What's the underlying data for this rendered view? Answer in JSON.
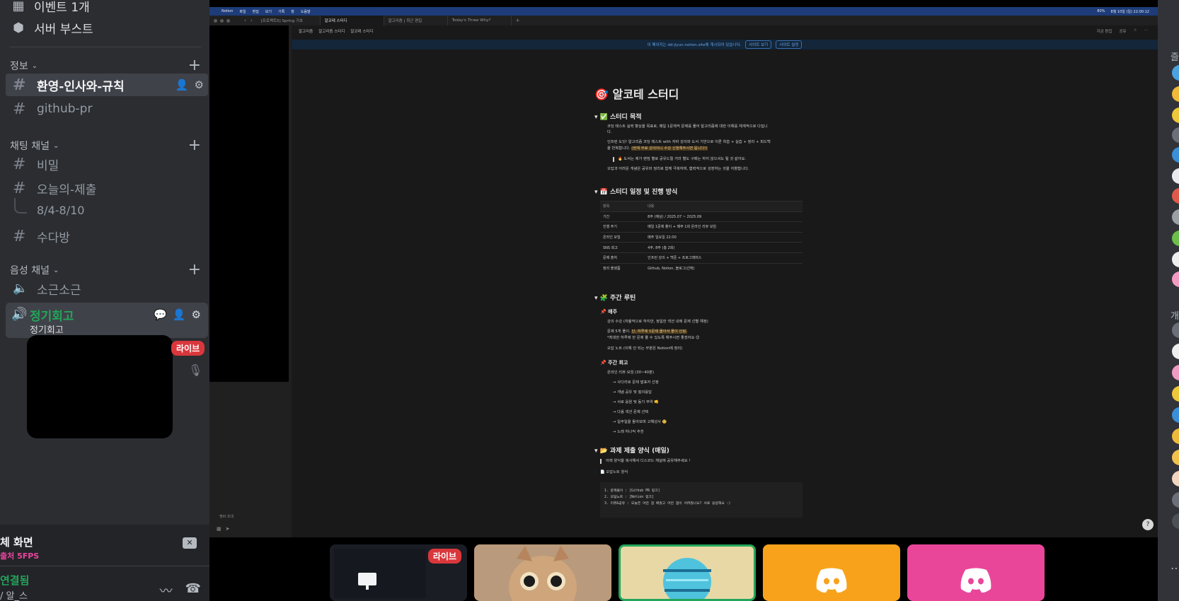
{
  "sidebar": {
    "top_items": [
      {
        "label": "이벤트 1개",
        "icon": "calendar-icon"
      },
      {
        "label": "서버 부스트",
        "icon": "boost-icon"
      }
    ],
    "categories": {
      "info": "정보",
      "chat": "채팅 채널",
      "voice": "음성 채널"
    },
    "channels": {
      "welcome": "환영-인사와-규칙",
      "github": "github-pr",
      "secret": "비밀",
      "submit": "오늘의-제출",
      "thread": "8/4-8/10",
      "talk": "수다방"
    },
    "voice_channels": {
      "quiet": "소근소근",
      "regular": "정기회고",
      "regular_sub": "정기회고"
    },
    "live_badge": "라이브"
  },
  "bottom_panel": {
    "screen_label": "체 화면",
    "screen_sub": "출처 5FPS",
    "connected_label": "연결됨",
    "connected_sub": "/ 알_스"
  },
  "stream": {
    "menubar": {
      "items": [
        "Notion",
        "파일",
        "편집",
        "보기",
        "기록",
        "창",
        "도움말"
      ],
      "clock": "8월 10일 (일) 22:00:12",
      "battery": "80%"
    },
    "tabs": [
      "[프로젝트5] Spring 기초",
      "알코테 스터디",
      "알고리즘 | 최근 편집",
      "Today's Three Why?"
    ],
    "breadcrumb": [
      "알고리즘",
      "알고리즘 스터디",
      "알코테 스터디"
    ],
    "top_right": [
      "지금 편집",
      "공유",
      "☆",
      "⋯"
    ],
    "banner": {
      "text": "이 페이지는 dd-jiyun.notion.site에 게시되어 있습니다.",
      "view_site": "사이트 보기",
      "site_settings": "사이트 설정"
    },
    "sidebar_bottom": "멤버 초대",
    "doc": {
      "title": "알코테 스터디",
      "sec1": "✅ 스터디 목적",
      "sec1_lines": [
        "코딩 테스트 실력 향상을 목표로, 매일 1문제씩 문제를 풀어 알고리즘에 대한 이해를 체계적으로 다집니",
        "다.",
        "인프런 도잇! 알고리즘 코딩 테스트 with 자바 강의와 도서 기반으로 이론 학습 + 실습 + 정리 + 피드백",
        "을 반복합니다.",
        "(현재 무료 강의이니 수강 신청해주시면 됩니다!)",
        "🔥 도서는 제가 랜덤 별로 공유드릴 거라 별도 구매는 하지 않으셔도 될 것 같아요.",
        "오답과 어려운 개념은 공유와 정리로 함께 극복하며, 협력적으로 성장하는 것을 지향합니다."
      ],
      "sec2": "📅 스터디 일정 및 진행 방식",
      "table": [
        [
          "항목",
          "내용"
        ],
        [
          "기간",
          "8주 (예상) / 2025.07 ~ 2025.09"
        ],
        [
          "진행 주기",
          "매일 1문제 풀이 + 매주 1회 온라인 리뷰 모임"
        ],
        [
          "온라인 모임",
          "매주 일요일 22:00"
        ],
        [
          "SNS 회고",
          "4주, 8주 (총 2회)"
        ],
        [
          "문제 출처",
          "인프런 강의 + 백준 + 프로그래머스"
        ],
        [
          "정리 플랫폼",
          "Github, Notion, 블로그(선택)"
        ]
      ],
      "sec3": "🧩 주간 루틴",
      "daily": "📌 매주",
      "daily_lines": [
        "강의 수강 (자율적으로 하지만, 정일한 섹션 내에 문제 선별 예정)",
        "문제 5개 풀이.",
        "단, 하루에 5문제 몰아서 풀이 안됨.",
        "*최대한 하루에 한 문제 풀 수 있도록 해주시면 좋겠어요 😊",
        "오답 노트 (이해 안 되는 부분은 Notion에 정리)"
      ],
      "weekly": "📌 주간 회고",
      "weekly_lines": [
        "온라인 리뷰 모임 (30~40분)",
        "→ 사다리로 문제 발표자 선정",
        "→ 개념 공유 및 질의응답",
        "→ 서로 응원 및 동기 부여 👊",
        "→ 다음 섹션 문제 선택",
        "→ 일주일을 돌아보며 고해성사 🧐",
        "→ 노래 하나씩 추천"
      ],
      "sec4": "📂 과제 제출 양식 (매일)",
      "quote": "아래 양식을 복사해서 디스코드 채널에 공유해주세요 !",
      "note_link": "오답노트 양식",
      "code": "1. 문제풀이 : [Github PR 링크]\n2. 오답노트 : [Notion 링크]\n3. 리뷰&공유 : 오늘은 어떤 걸 배웠고 어떤 점이 어려웠나요? 서로 응원해요 :)"
    },
    "thumb_live_badge": "라이브"
  },
  "right_panel": {
    "texts": [
      "즐",
      "개"
    ]
  }
}
